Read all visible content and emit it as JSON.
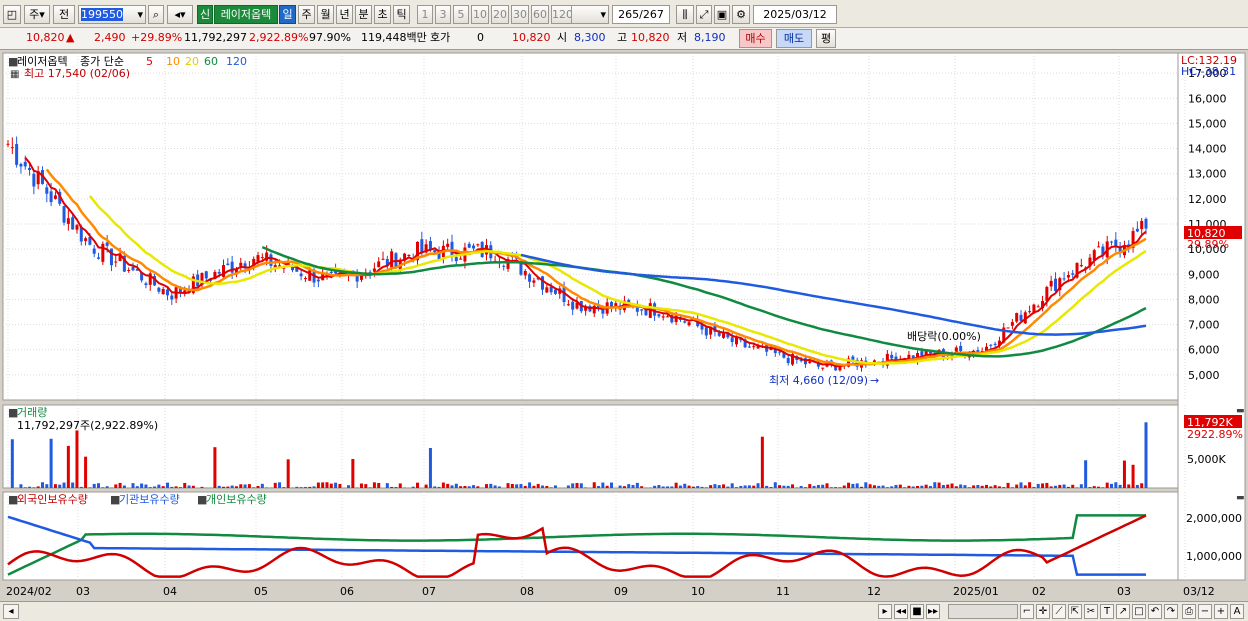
{
  "toolbar": {
    "market": "주",
    "prev": "전",
    "code": "199550",
    "sin": "신",
    "name": "레이저옵텍",
    "periods": [
      "일",
      "주",
      "월",
      "년",
      "분",
      "초",
      "틱"
    ],
    "period_selected": 0,
    "nums": [
      "1",
      "3",
      "5",
      "10",
      "20",
      "30",
      "60",
      "120"
    ],
    "count": "265",
    "total": "/267",
    "date": "2025/03/12"
  },
  "quote": {
    "price": "10,820",
    "arrow": "▲",
    "change": "2,490",
    "pct": "+29.89%",
    "volume": "11,792,297",
    "vol_pct": "2,922.89%",
    "ratio": "97.90%",
    "amount": "119,448백만",
    "hoga_label": "호가",
    "hoga": "0",
    "hoga_price": "10,820",
    "open_label": "시",
    "open": "8,300",
    "high_label": "고",
    "high": "10,820",
    "low_label": "저",
    "low": "8,190",
    "buy": "매수",
    "sell": "매도",
    "eval": "평"
  },
  "price_pane": {
    "title": "레이저옵텍",
    "ma_label": "종가 단순",
    "ma": [
      {
        "p": "5",
        "color": "#e00000"
      },
      {
        "p": "10",
        "color": "#ff8a00"
      },
      {
        "p": "20",
        "color": "#e8e800"
      },
      {
        "p": "60",
        "color": "#108a40"
      },
      {
        "p": "120",
        "color": "#1f5ae0"
      }
    ],
    "high_note": "최고 17,540 (02/06)",
    "low_note": "최저 4,660 (12/09)",
    "div_note": "배당락(0.00%)",
    "lc": "LC:132.19",
    "hc": "HC:-38.31",
    "last_price": "10,820",
    "last_pct": "29.89%"
  },
  "vol_pane": {
    "title": "거래량",
    "info": "11,792,297주(2,922.89%)",
    "last": "11,792K",
    "last_pct": "2922.89%",
    "tick": "5,000K"
  },
  "holding_pane": {
    "series": [
      {
        "name": "외국인보유수량",
        "color": "#d00000"
      },
      {
        "name": "기관보유수량",
        "color": "#1f5ae0"
      },
      {
        "name": "개인보유수량",
        "color": "#108a40"
      }
    ],
    "ticks": [
      "2,000,000",
      "1,000,000"
    ]
  },
  "x_axis": [
    "2024/02",
    "03",
    "04",
    "05",
    "06",
    "07",
    "08",
    "09",
    "10",
    "11",
    "12",
    "2025/01",
    "02",
    "03",
    "03/12"
  ],
  "chart_data": {
    "type": "line",
    "title": "레이저옵텍",
    "x": [
      "2024/02",
      "03",
      "04",
      "05",
      "06",
      "07",
      "08",
      "09",
      "10",
      "11",
      "12",
      "2025/01",
      "02",
      "03"
    ],
    "ylim": [
      4000,
      17800
    ],
    "y_ticks": [
      5000,
      6000,
      7000,
      8000,
      9000,
      10000,
      11000,
      12000,
      13000,
      14000,
      15000,
      16000,
      17000
    ],
    "series": [
      {
        "name": "종가",
        "values": [
          14200,
          10200,
          8200,
          9700,
          8700,
          9900,
          9900,
          7800,
          7600,
          6200,
          5300,
          5700,
          6000,
          9000,
          10820
        ]
      }
    ],
    "legend": "top-left"
  }
}
